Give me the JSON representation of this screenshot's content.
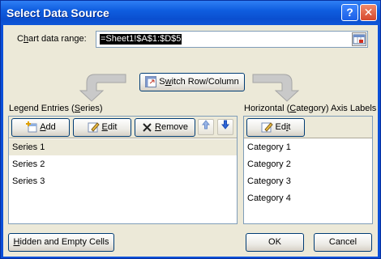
{
  "window": {
    "title": "Select Data Source",
    "help_glyph": "?",
    "close_glyph": "✕"
  },
  "range": {
    "label_pre": "C",
    "label_u": "h",
    "label_post": "art data range:",
    "value": "=Sheet1!$A$1:$D$5"
  },
  "switch_button": {
    "label_pre": "S",
    "label_u": "w",
    "label_post": "itch Row/Column"
  },
  "legend": {
    "label_pre": "Legend Entries (",
    "label_u": "S",
    "label_post": "eries)",
    "add_pre": "",
    "add_u": "A",
    "add_post": "dd",
    "edit_pre": "",
    "edit_u": "E",
    "edit_post": "dit",
    "remove_pre": "",
    "remove_u": "R",
    "remove_post": "emove",
    "items": [
      "Series 1",
      "Series 2",
      "Series 3"
    ],
    "selected_index": 0
  },
  "axis": {
    "label_pre": "Horizontal (",
    "label_u": "C",
    "label_post": "ategory) Axis Labels",
    "edit_pre": "Ed",
    "edit_u": "i",
    "edit_post": "t",
    "items": [
      "Category 1",
      "Category 2",
      "Category 3",
      "Category 4"
    ]
  },
  "footer": {
    "hidden_pre": "",
    "hidden_u": "H",
    "hidden_post": "idden and Empty Cells",
    "ok_label": "OK",
    "cancel_label": "Cancel"
  },
  "colors": {
    "titlebar": "#0a4fd8",
    "dialog_bg": "#ece9d8",
    "list_border": "#7f9db9",
    "up_arrow": "#5a8ae0",
    "down_arrow": "#2a5fd6"
  },
  "icons": [
    "help-icon",
    "close-icon",
    "range-picker-icon",
    "switch-icon",
    "add-icon",
    "edit-icon",
    "remove-icon",
    "move-up-icon",
    "move-down-icon"
  ]
}
